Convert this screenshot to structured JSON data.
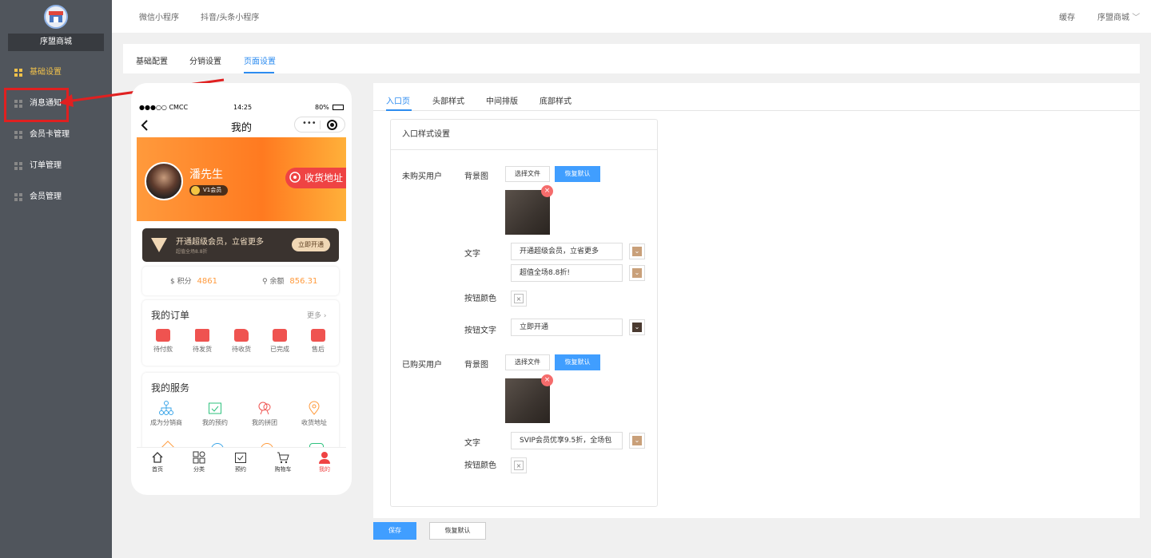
{
  "sidebar": {
    "store_name": "序盟商城",
    "items": [
      {
        "label": "基础设置"
      },
      {
        "label": "消息通知"
      },
      {
        "label": "会员卡管理"
      },
      {
        "label": "订单管理"
      },
      {
        "label": "会员管理"
      }
    ]
  },
  "topbar": {
    "left_tabs": [
      "微信小程序",
      "抖音/头条小程序"
    ],
    "cache_label": "缓存",
    "store_dropdown": "序盟商城"
  },
  "settings_tabs": [
    {
      "label": "基础配置"
    },
    {
      "label": "分销设置"
    },
    {
      "label": "页面设置"
    }
  ],
  "phone": {
    "carrier": "●●●○○ CMCC",
    "time": "14:25",
    "battery": "80%",
    "nav_title": "我的",
    "capsule_more": "•••",
    "user_name": "潘先生",
    "member_level": "V1会员",
    "address_button": "收货地址",
    "vip_main": "开通超级会员，立省更多",
    "vip_sub": "超值全场8.8折",
    "vip_button": "立即开通",
    "points_label": "积分",
    "points_value": "4861",
    "balance_label": "余额",
    "balance_value": "856.31",
    "orders_title": "我的订单",
    "orders_more": "更多",
    "orders": [
      {
        "label": "待付款"
      },
      {
        "label": "待发货"
      },
      {
        "label": "待收货"
      },
      {
        "label": "已完成"
      },
      {
        "label": "售后"
      }
    ],
    "services_title": "我的服务",
    "services": [
      {
        "label": "成为分销商"
      },
      {
        "label": "我的预约"
      },
      {
        "label": "我的拼团"
      },
      {
        "label": "收货地址"
      }
    ],
    "tabbar": [
      {
        "label": "首页"
      },
      {
        "label": "分类"
      },
      {
        "label": "预约"
      },
      {
        "label": "购物车"
      },
      {
        "label": "我的"
      }
    ]
  },
  "page_tabs": [
    {
      "label": "入口页"
    },
    {
      "label": "头部样式"
    },
    {
      "label": "中间排版"
    },
    {
      "label": "底部样式"
    }
  ],
  "panel": {
    "title": "入口样式设置",
    "not_purchased": "未购买用户",
    "purchased": "已购买用户",
    "bg_label": "背景图",
    "choose_file": "选择文件",
    "restore_default": "恢复默认",
    "text_label": "文字",
    "btn_color_label": "按钮颜色",
    "btn_text_label": "按钮文字",
    "np_text1": "开通超级会员，立省更多",
    "np_text2": "超值全场8.8折!",
    "np_btn_text": "立即开通",
    "p_text1": "SVIP会员优享9.5折，全场包",
    "delete_mark": "×"
  },
  "footer": {
    "save": "保存",
    "restore": "恢复默认"
  },
  "colors": {
    "accent": "#409eff",
    "sidebar": "#50555c",
    "swatch_tan": "#c9a07a",
    "swatch_dark": "#4a3a30",
    "banner_orange": "#ff8a2a"
  }
}
